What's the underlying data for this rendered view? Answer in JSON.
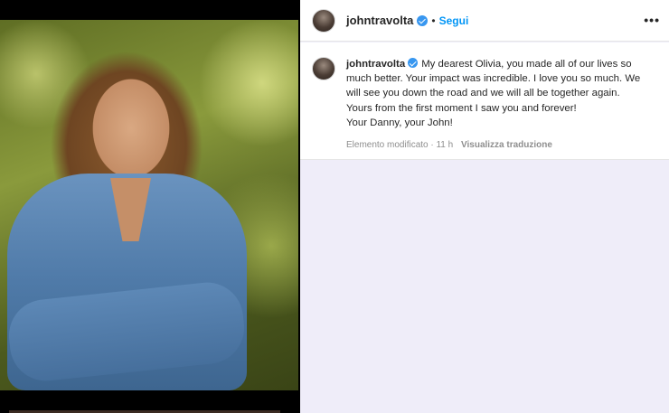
{
  "post": {
    "username": "johntravolta",
    "separator": "•",
    "follow_label": "Segui",
    "more_label": "•••",
    "caption_lines": [
      "My dearest Olivia, you made all of our lives so",
      "much better. Your impact was incredible. I love you so much. We",
      "will see you down the road and we will all be together again.",
      "Yours from the first moment I saw you and forever!",
      "Your Danny, your John!"
    ],
    "edited_time": "Elemento modificato · 11 h",
    "translate_label": "Visualizza traduzione"
  },
  "icons": {
    "verified": "verified-badge-icon",
    "more": "more-options-icon"
  },
  "colors": {
    "link_blue": "#0095f6",
    "verified_blue": "#3897f0",
    "sidebar_bg": "#efedf9",
    "text": "#262626",
    "muted": "#8e8e8e"
  }
}
